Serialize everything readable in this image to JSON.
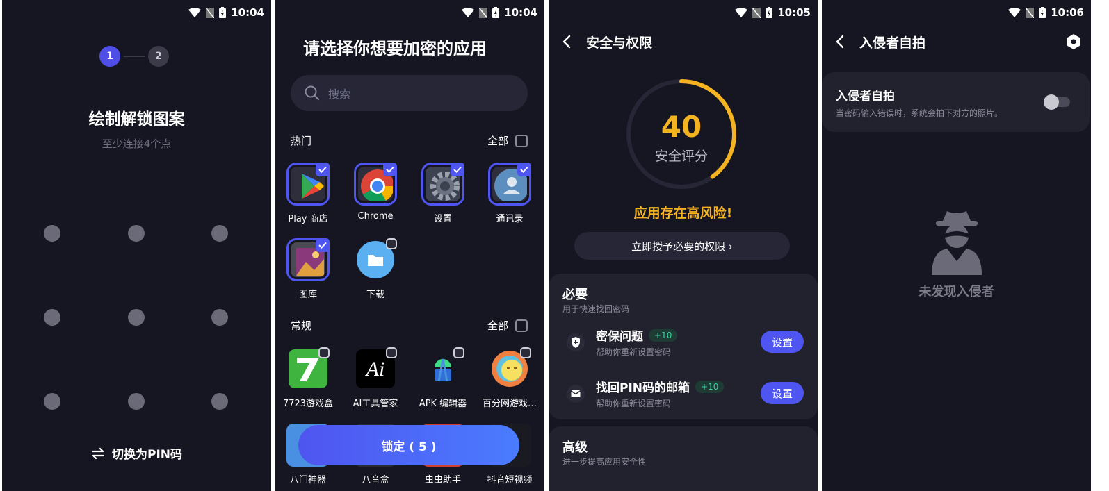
{
  "screens": [
    {
      "status_time": "10:04",
      "steps": [
        "1",
        "2"
      ],
      "title": "绘制解锁图案",
      "subtitle": "至少连接4个点",
      "switch_label": "切换为PIN码"
    },
    {
      "status_time": "10:04",
      "title": "请选择你想要加密的应用",
      "search_placeholder": "搜索",
      "sections": [
        {
          "label": "热门",
          "all_label": "全部"
        },
        {
          "label": "常规",
          "all_label": "全部"
        }
      ],
      "popular_apps": [
        {
          "label": "Play 商店",
          "icon": "play-store-icon",
          "selected": true
        },
        {
          "label": "Chrome",
          "icon": "chrome-icon",
          "selected": true
        },
        {
          "label": "设置",
          "icon": "settings-gear-icon",
          "selected": true
        },
        {
          "label": "通讯录",
          "icon": "contacts-icon",
          "selected": true
        },
        {
          "label": "图库",
          "icon": "gallery-icon",
          "selected": true
        },
        {
          "label": "下载",
          "icon": "downloads-folder-icon",
          "selected": false
        }
      ],
      "general_apps": [
        {
          "label": "7723游戏盒",
          "icon": "7723-game-box-icon",
          "selected": false
        },
        {
          "label": "AI工具管家",
          "icon": "ai-tools-icon",
          "selected": false
        },
        {
          "label": "APK 编辑器",
          "icon": "apk-editor-android-icon",
          "selected": false
        },
        {
          "label": "百分网游戏…",
          "icon": "baifen-game-icon",
          "selected": false
        }
      ],
      "partial_apps": [
        "八门神器",
        "八音盒",
        "虫虫助手",
        "抖音短视频"
      ],
      "lock_button": "锁定 ( 5 )"
    },
    {
      "status_time": "10:05",
      "title": "安全与权限",
      "score": "40",
      "score_label": "安全评分",
      "score_fraction": 0.4,
      "risk_text": "应用存在高风险!",
      "grant_button": "立即授予必要的权限 ›",
      "required": {
        "title": "必要",
        "subtitle": "用于快速找回密码",
        "items": [
          {
            "name": "密保问题",
            "badge": "+10",
            "desc": "帮助你重新设置密码",
            "button": "设置",
            "icon": "shield-icon"
          },
          {
            "name": "找回PIN码的邮箱",
            "badge": "+10",
            "desc": "帮助你重新设置密码",
            "button": "设置",
            "icon": "mail-icon"
          }
        ]
      },
      "advanced": {
        "title": "高级",
        "subtitle": "进一步提高应用安全性"
      }
    },
    {
      "status_time": "10:06",
      "title": "入侵者自拍",
      "card_title": "入侵者自拍",
      "card_desc": "当密码输入错误时，系统会拍下对方的照片。",
      "toggle_on": false,
      "empty_text": "未发现入侵者"
    }
  ],
  "colors": {
    "accent": "#4f55f0",
    "warning": "#f4b320",
    "background": "#161622",
    "card": "#22222f",
    "badge_green": "#37d6a6"
  }
}
